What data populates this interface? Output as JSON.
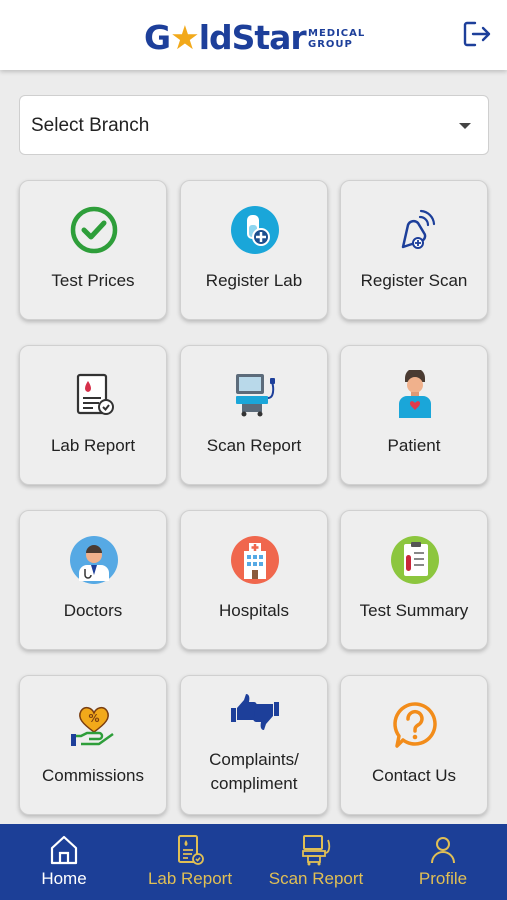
{
  "header": {
    "logo_main_before": "G",
    "logo_main_after": "ldStar",
    "logo_sub_line1": "MEDICAL",
    "logo_sub_line2": "GROUP",
    "logout_icon": "logout-icon",
    "brand_color": "#1d3f9a",
    "accent_color": "#f2a91a"
  },
  "branch_select": {
    "placeholder": "Select Branch"
  },
  "tiles": [
    {
      "label": "Test Prices",
      "icon": "check-circle-icon"
    },
    {
      "label": "Register Lab",
      "icon": "lab-flask-plus-icon"
    },
    {
      "label": "Register Scan",
      "icon": "scan-probe-icon"
    },
    {
      "label": "Lab Report",
      "icon": "lab-report-icon"
    },
    {
      "label": "Scan Report",
      "icon": "ultrasound-machine-icon"
    },
    {
      "label": "Patient",
      "icon": "patient-icon"
    },
    {
      "label": "Doctors",
      "icon": "doctor-icon"
    },
    {
      "label": "Hospitals",
      "icon": "hospital-icon"
    },
    {
      "label": "Test Summary",
      "icon": "test-summary-icon"
    },
    {
      "label": "Commissions",
      "icon": "commission-hand-heart-icon"
    },
    {
      "label_line1": "Complaints/",
      "label_line2": "compliment",
      "icon": "thumbs-up-down-icon"
    },
    {
      "label": "Contact Us",
      "icon": "question-bubble-icon"
    }
  ],
  "bottom_nav": {
    "items": [
      {
        "label": "Home",
        "icon": "home-icon",
        "active": true
      },
      {
        "label": "Lab Report",
        "icon": "lab-report-icon",
        "active": false
      },
      {
        "label": "Scan Report",
        "icon": "scan-machine-icon",
        "active": false
      },
      {
        "label": "Profile",
        "icon": "user-icon",
        "active": false
      }
    ],
    "background": "#1c3f97",
    "active_color": "#ffffff",
    "inactive_color": "#e0bf55"
  }
}
